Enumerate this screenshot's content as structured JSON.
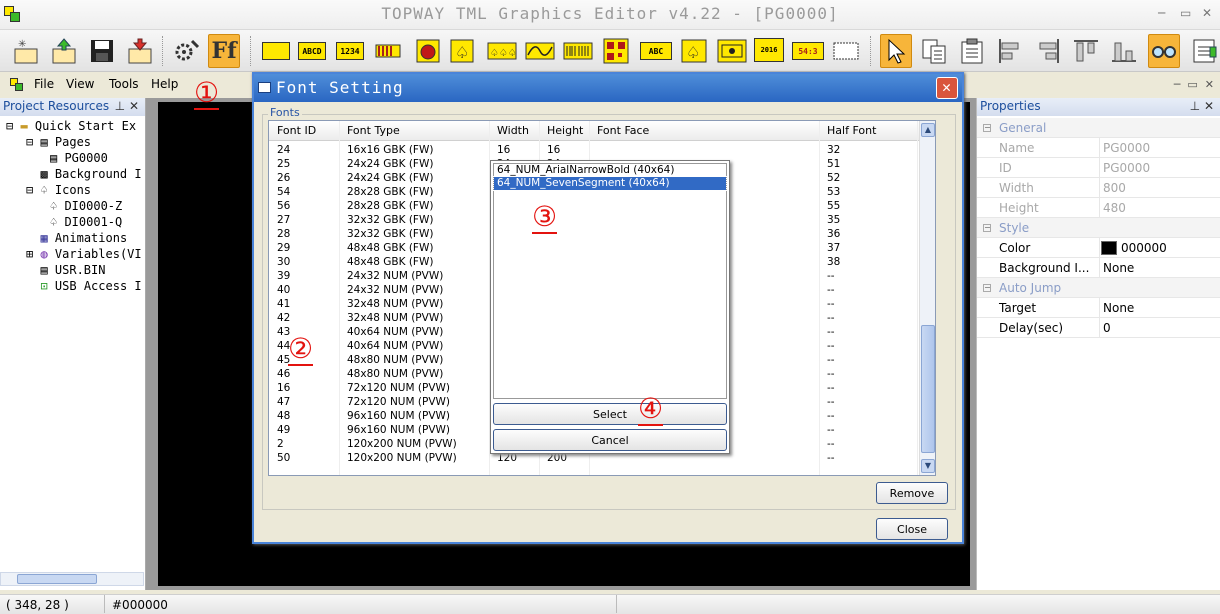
{
  "app": {
    "title": "TOPWAY TML Graphics Editor v4.22 - [PG0000]"
  },
  "menu": {
    "items": [
      "File",
      "View",
      "Tools",
      "Help"
    ]
  },
  "toolbar": {
    "labels": [
      "ABCD",
      "1234",
      "ABC",
      "2016",
      "54:3"
    ]
  },
  "project": {
    "title": "Project Resources",
    "tree": [
      "Quick Start Ex",
      "Pages",
      "PG0000",
      "Background I",
      "Icons",
      "DI0000-Z",
      "DI0001-Q",
      "Animations",
      "Variables(VI",
      "USR.BIN",
      "USB Access I"
    ]
  },
  "dialog": {
    "title": "Font Setting",
    "group_label": "Fonts",
    "columns": [
      "Font ID",
      "Font Type",
      "Width",
      "Height",
      "Font Face",
      "Half Font"
    ],
    "rows": [
      [
        "24",
        "16x16 GBK (FW)",
        "16",
        "16",
        "",
        "32"
      ],
      [
        "25",
        "24x24 GBK (FW)",
        "24",
        "24",
        "",
        "51"
      ],
      [
        "26",
        "24x24 GBK (FW)",
        "",
        "",
        "",
        "52"
      ],
      [
        "54",
        "28x28 GBK (FW)",
        "",
        "",
        "",
        "53"
      ],
      [
        "56",
        "28x28 GBK (FW)",
        "",
        "",
        "",
        "55"
      ],
      [
        "27",
        "32x32 GBK (FW)",
        "",
        "",
        "",
        "35"
      ],
      [
        "28",
        "32x32 GBK (FW)",
        "",
        "",
        "",
        "36"
      ],
      [
        "29",
        "48x48 GBK (FW)",
        "",
        "",
        "",
        "37"
      ],
      [
        "30",
        "48x48 GBK (FW)",
        "",
        "",
        "",
        "38"
      ],
      [
        "39",
        "24x32 NUM (PVW)",
        "",
        "",
        "",
        "--"
      ],
      [
        "40",
        "24x32 NUM (PVW)",
        "",
        "",
        "",
        "--"
      ],
      [
        "41",
        "32x48 NUM (PVW)",
        "",
        "",
        "",
        "--"
      ],
      [
        "42",
        "32x48 NUM (PVW)",
        "",
        "",
        "",
        "--"
      ],
      [
        "43",
        "40x64 NUM (PVW)",
        "",
        "",
        "",
        "--"
      ],
      [
        "44",
        "40x64 NUM (PVW)",
        "",
        "",
        "",
        "--"
      ],
      [
        "45",
        "48x80 NUM (PVW)",
        "",
        "",
        "",
        "--"
      ],
      [
        "46",
        "48x80 NUM (PVW)",
        "",
        "",
        "",
        "--"
      ],
      [
        "16",
        "72x120 NUM (PVW)",
        "",
        "",
        "",
        "--"
      ],
      [
        "47",
        "72x120 NUM (PVW)",
        "",
        "",
        "",
        "--"
      ],
      [
        "48",
        "96x160 NUM (PVW)",
        "",
        "",
        "",
        "--"
      ],
      [
        "49",
        "96x160 NUM (PVW)",
        "",
        "",
        "",
        "--"
      ],
      [
        "2",
        "120x200 NUM (PVW)",
        "",
        "",
        "",
        "--"
      ],
      [
        "50",
        "120x200 NUM (PVW)",
        "120",
        "200",
        "",
        "--"
      ]
    ],
    "remove_label": "Remove",
    "close_label": "Close"
  },
  "popup": {
    "options": [
      "64_NUM_ArialNarrowBold (40x64)",
      "64_NUM_SevenSegment (40x64)"
    ],
    "selected_index": 1,
    "select_label": "Select",
    "cancel_label": "Cancel"
  },
  "annotations": [
    "①",
    "②",
    "③",
    "④"
  ],
  "properties": {
    "title": "Properties",
    "rows": [
      {
        "kind": "cat",
        "k": "General"
      },
      {
        "kind": "ro",
        "k": "Name",
        "v": "PG0000"
      },
      {
        "kind": "ro",
        "k": "ID",
        "v": "PG0000"
      },
      {
        "kind": "ro",
        "k": "Width",
        "v": "800"
      },
      {
        "kind": "ro",
        "k": "Height",
        "v": "480"
      },
      {
        "kind": "cat",
        "k": "Style"
      },
      {
        "kind": "val",
        "k": "Color",
        "v": "000000",
        "swatch": "#000000"
      },
      {
        "kind": "val",
        "k": "Background I...",
        "v": "None"
      },
      {
        "kind": "cat",
        "k": "Auto Jump"
      },
      {
        "kind": "val",
        "k": "Target",
        "v": "None"
      },
      {
        "kind": "val",
        "k": "Delay(sec)",
        "v": "0"
      }
    ]
  },
  "status": {
    "coords": "( 348, 28 )",
    "color": "#000000"
  },
  "colors": {
    "accent": "#316ac5",
    "annotation": "#e3130f",
    "active_tool": "#f7b53a"
  }
}
